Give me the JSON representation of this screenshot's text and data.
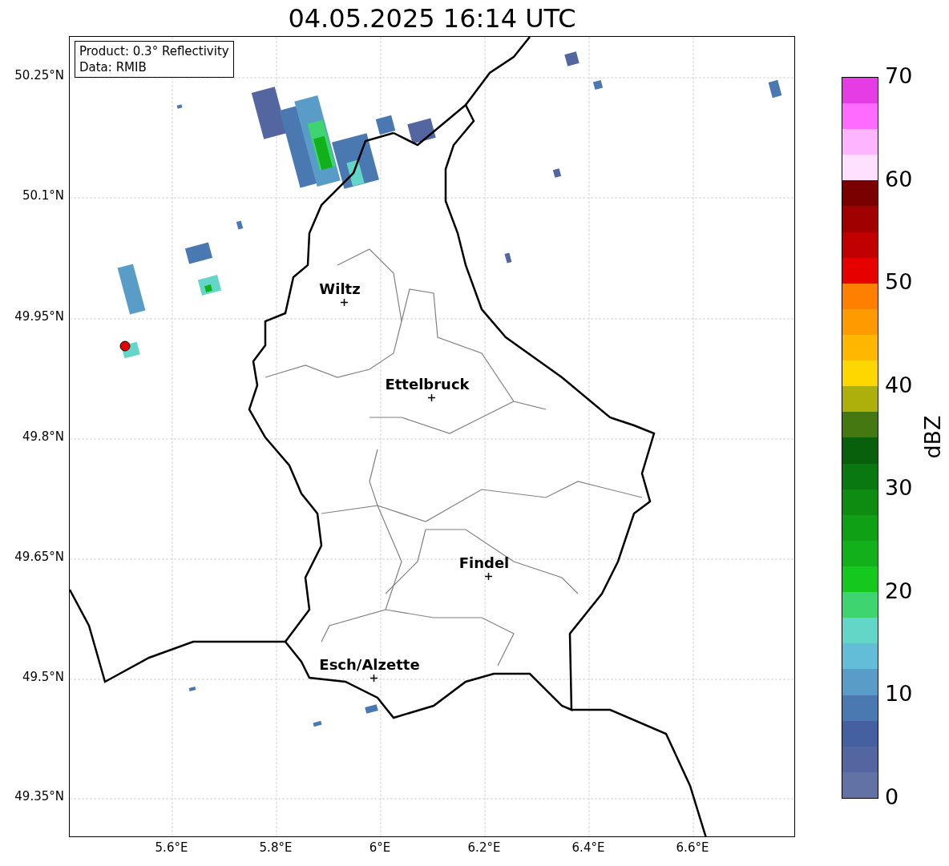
{
  "title": "04.05.2025 16:14 UTC",
  "info_box": [
    "Product: 0.3° Reflectivity",
    "Data: RMIB"
  ],
  "lat_ticks": [
    "50.25°N",
    "50.1°N",
    "49.95°N",
    "49.8°N",
    "49.65°N",
    "49.5°N",
    "49.35°N"
  ],
  "lon_ticks": [
    "5.6°E",
    "5.8°E",
    "6°E",
    "6.2°E",
    "6.4°E",
    "6.6°E"
  ],
  "cities": [
    {
      "name": "Wiltz"
    },
    {
      "name": "Ettelbruck"
    },
    {
      "name": "Findel"
    },
    {
      "name": "Esch/Alzette"
    }
  ],
  "colorbar": {
    "label": "dBZ",
    "ticks": [
      "70",
      "60",
      "50",
      "40",
      "30",
      "20",
      "10",
      "0"
    ],
    "bins": [
      {
        "color": "#6272a5"
      },
      {
        "color": "#5466a0"
      },
      {
        "color": "#4560a0"
      },
      {
        "color": "#4a78b0"
      },
      {
        "color": "#5a9cc8"
      },
      {
        "color": "#63bcd8"
      },
      {
        "color": "#63d6c8"
      },
      {
        "color": "#3ed470"
      },
      {
        "color": "#14c81e"
      },
      {
        "color": "#12b01a"
      },
      {
        "color": "#10a015"
      },
      {
        "color": "#0e8c12"
      },
      {
        "color": "#0a7810"
      },
      {
        "color": "#08600c"
      },
      {
        "color": "#457810"
      },
      {
        "color": "#adb00a"
      },
      {
        "color": "#ffd700"
      },
      {
        "color": "#ffb700"
      },
      {
        "color": "#ff9b00"
      },
      {
        "color": "#ff7f00"
      },
      {
        "color": "#e60000"
      },
      {
        "color": "#c00000"
      },
      {
        "color": "#a00000"
      },
      {
        "color": "#7a0000"
      },
      {
        "color": "#ffe0ff"
      },
      {
        "color": "#ffb4ff"
      },
      {
        "color": "#ff6aff"
      },
      {
        "color": "#e63ce6"
      }
    ]
  }
}
